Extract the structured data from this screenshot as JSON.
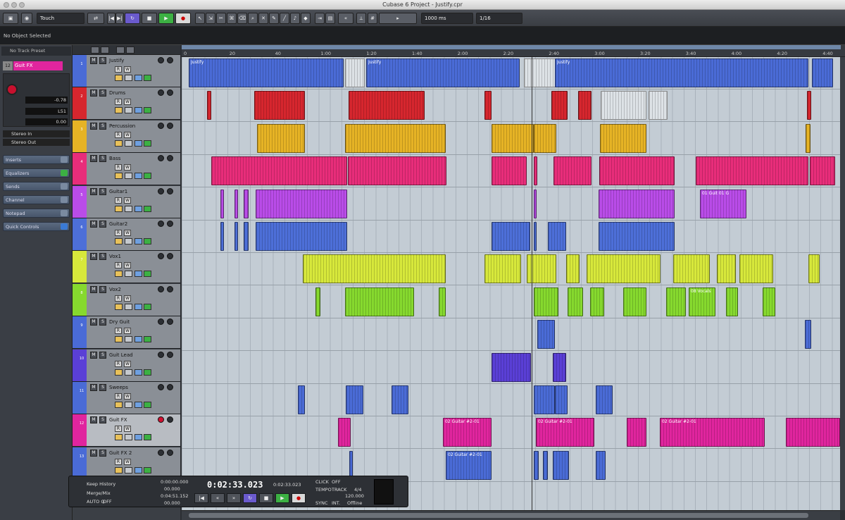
{
  "window": {
    "title": "Cubase 6 Project - Justify.cpr"
  },
  "toolbar": {
    "automation_mode": "Touch",
    "nudge_value": "1000 ms",
    "quantize_value": "1/16"
  },
  "info_line": "No Object Selected",
  "inspector": {
    "preset": "No Track Preset",
    "track_number": "12",
    "track_name": "Guit FX",
    "volume": "-0.78",
    "pan": "L51",
    "delay": "0.00",
    "input": "Stereo In",
    "output": "Stereo Out",
    "sections": [
      "Inserts",
      "Equalizers",
      "Sends",
      "Channel",
      "Notepad",
      "Quick Controls"
    ]
  },
  "ruler_ticks": [
    "0",
    "20",
    "40",
    "1:00",
    "1:20",
    "1:40",
    "2:00",
    "2:20",
    "2:40",
    "3:00",
    "3:20",
    "3:40",
    "4:00",
    "4:20",
    "4:40"
  ],
  "tracks": [
    {
      "num": "1",
      "name": "Justify",
      "color": "#4a6bd6"
    },
    {
      "num": "2",
      "name": "Drums",
      "color": "#d6262e"
    },
    {
      "num": "3",
      "name": "Percussion",
      "color": "#e6b325"
    },
    {
      "num": "4",
      "name": "Bass",
      "color": "#e82d7a"
    },
    {
      "num": "5",
      "name": "Guitar1",
      "color": "#b94ce8"
    },
    {
      "num": "6",
      "name": "Guitar2",
      "color": "#4d6fd8"
    },
    {
      "num": "7",
      "name": "Vox1",
      "color": "#d7e83b"
    },
    {
      "num": "8",
      "name": "Vox2",
      "color": "#86d92e"
    },
    {
      "num": "9",
      "name": "Dry Guit",
      "color": "#4a6bd6"
    },
    {
      "num": "10",
      "name": "Guit Lead",
      "color": "#5a3fd6"
    },
    {
      "num": "11",
      "name": "Sweeps",
      "color": "#4a6bd6"
    },
    {
      "num": "12",
      "name": "Guit FX",
      "color": "#e0259e"
    },
    {
      "num": "13",
      "name": "Guit FX 2",
      "color": "#4a6bd6"
    }
  ],
  "event_labels": {
    "justify": "Justify",
    "guit_01": "01 Guit 01 G",
    "vocals_08": "08 Vocals",
    "guitar2_01": "02 Guitar #2-01"
  },
  "transport": {
    "history_label": "Keep History",
    "mix_label": "Merge/Mix",
    "auto_label": "AUTO Q",
    "auto_state": "OFF",
    "left_locator": "0:00:00.000",
    "left_sub": "00.000",
    "right_locator": "0:04:51.152",
    "right_sub": "00.000",
    "position": "0:02:33.023",
    "position_secondary": "0:02:33.023",
    "click_label": "CLICK",
    "click_state": "OFF",
    "tempo_label": "TEMPO",
    "tempo_mode": "TRACK",
    "signature": "4/4",
    "tempo_value": "120.000",
    "sync_label": "SYNC",
    "sync_source": "INT.",
    "sync_state": "Offline"
  }
}
